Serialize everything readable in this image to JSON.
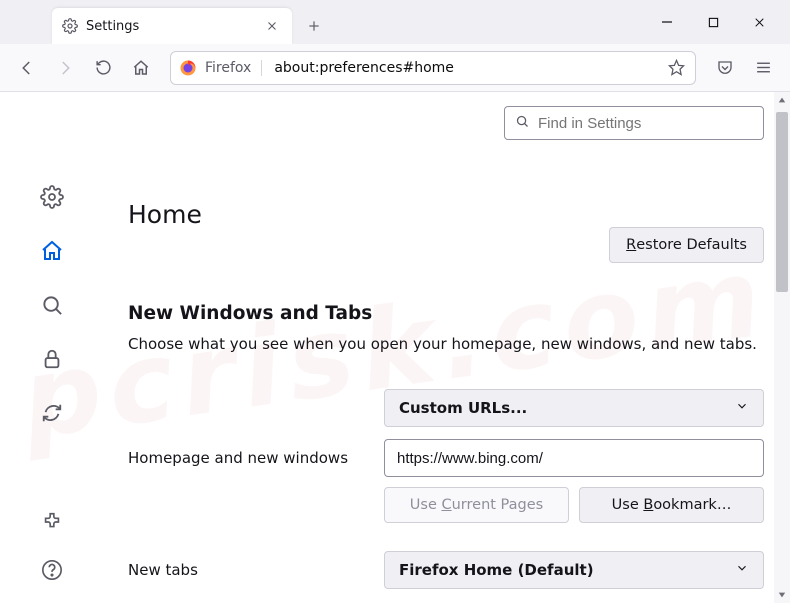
{
  "window": {
    "tab_title": "Settings",
    "new_tab_tooltip": "New Tab"
  },
  "toolbar": {
    "identity_label": "Firefox",
    "url": "about:preferences#home"
  },
  "search": {
    "placeholder": "Find in Settings"
  },
  "page": {
    "title": "Home",
    "restore_btn": "Restore Defaults",
    "section_title": "New Windows and Tabs",
    "section_desc": "Choose what you see when you open your homepage, new windows, and new tabs."
  },
  "homepage": {
    "label": "Homepage and new windows",
    "select_value": "Custom URLs...",
    "url_value": "https://www.bing.com/",
    "use_current": "Use Current Pages",
    "use_bookmark": "Use Bookmark…"
  },
  "newtabs": {
    "label": "New tabs",
    "select_value": "Firefox Home (Default)"
  }
}
